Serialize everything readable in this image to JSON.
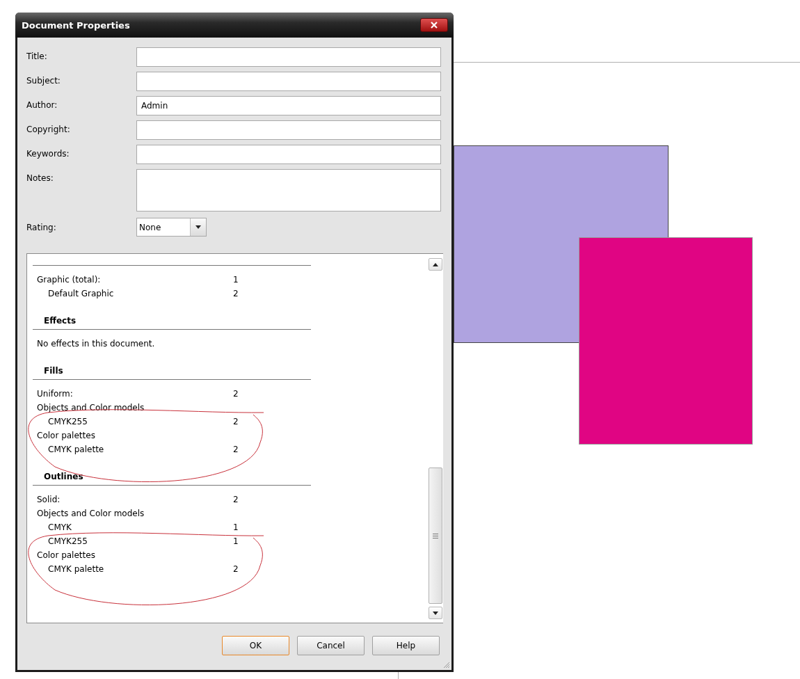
{
  "window": {
    "title": "Document Properties"
  },
  "fields": [
    {
      "label": "Title:",
      "kind": "line"
    },
    {
      "label": "Subject:",
      "kind": "line"
    },
    {
      "label": "Author:",
      "value": "Admin",
      "kind": "line"
    },
    {
      "label": "Copyright:",
      "kind": "line"
    },
    {
      "label": "Keywords:",
      "kind": "line"
    },
    {
      "label": "Notes:",
      "kind": "area"
    }
  ],
  "rating": {
    "label": "Rating:",
    "value": "None"
  },
  "report": [
    {
      "rows": [
        {
          "label": "Graphic (total):",
          "value": "1",
          "children": [
            {
              "label": "Default Graphic",
              "value": "2"
            }
          ]
        }
      ]
    },
    {
      "heading": "Effects",
      "note": "No effects in this document."
    },
    {
      "heading": "Fills",
      "rows": [
        {
          "label": "Uniform:",
          "value": "2"
        },
        {
          "label": "Objects and Color models",
          "children": [
            {
              "label": "CMYK255",
              "value": "2"
            }
          ]
        },
        {
          "label": "Color palettes",
          "children": [
            {
              "label": "CMYK palette",
              "value": "2"
            }
          ]
        }
      ]
    },
    {
      "heading": "Outlines",
      "rows": [
        {
          "label": "Solid:",
          "value": "2"
        },
        {
          "label": "Objects and Color models",
          "children": [
            {
              "label": "CMYK",
              "value": "1"
            },
            {
              "label": "CMYK255",
              "value": "1"
            }
          ]
        },
        {
          "label": "Color palettes",
          "children": [
            {
              "label": "CMYK palette",
              "value": "2"
            }
          ]
        }
      ]
    }
  ],
  "buttons": [
    {
      "label": "OK",
      "selected": true
    },
    {
      "label": "Cancel",
      "selected": false
    },
    {
      "label": "Help",
      "selected": false
    }
  ],
  "canvas": {
    "shapes": [
      {
        "kind": "rect",
        "color": "#afa3e0"
      },
      {
        "kind": "rect",
        "color": "#e00583"
      }
    ]
  }
}
